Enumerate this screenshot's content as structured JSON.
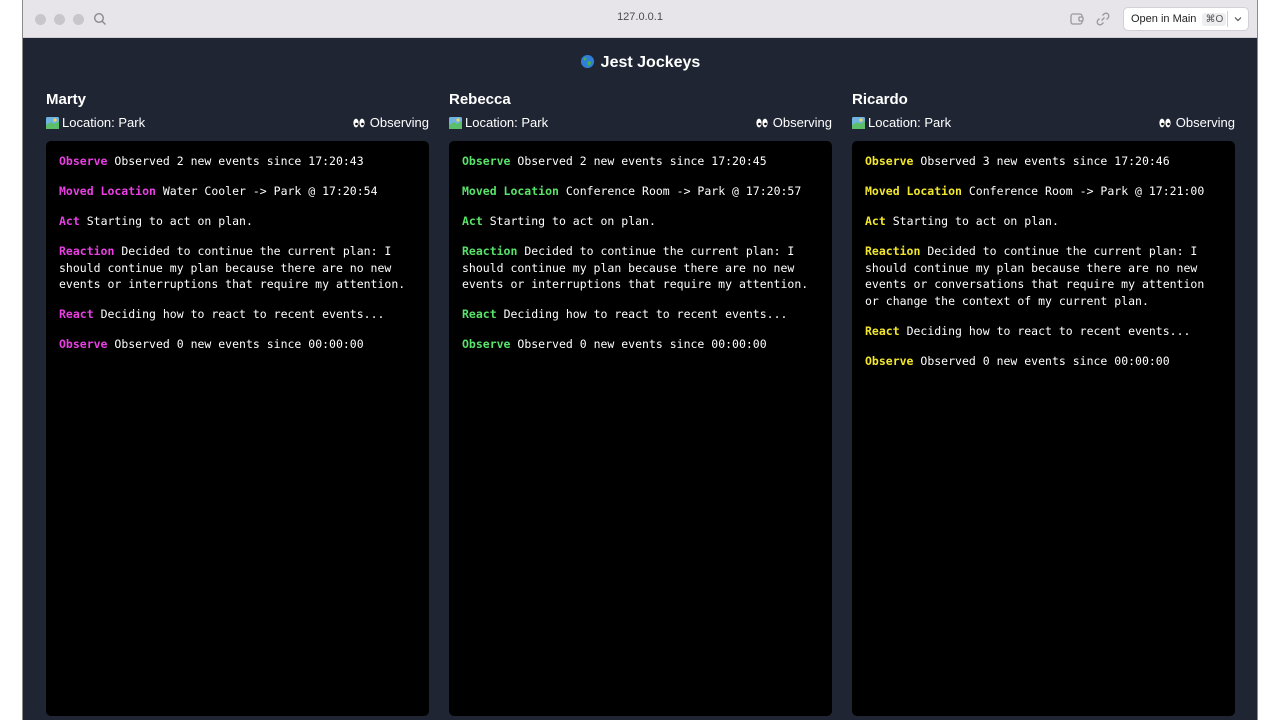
{
  "browser": {
    "url": "127.0.0.1",
    "open_main_label": "Open in Main",
    "open_main_shortcut": "⌘O"
  },
  "app": {
    "title": "Jest Jockeys",
    "title_icon": "globe-icon"
  },
  "agents": [
    {
      "name": "Marty",
      "location": "Location: Park",
      "status": "Observing",
      "accent": "#e93fe3",
      "log": [
        {
          "kind": "Observe",
          "text": "Observed 2 new events since 17:20:43"
        },
        {
          "kind": "Moved Location",
          "text": "Water Cooler -> Park @ 17:20:54"
        },
        {
          "kind": "Act",
          "text": "Starting to act on plan."
        },
        {
          "kind": "Reaction",
          "text": "Decided to continue the current plan: I should continue my plan because there are no new events or interruptions that require my attention."
        },
        {
          "kind": "React",
          "text": "Deciding how to react to recent events..."
        },
        {
          "kind": "Observe",
          "text": "Observed 0 new events since 00:00:00"
        }
      ]
    },
    {
      "name": "Rebecca",
      "location": "Location: Park",
      "status": "Observing",
      "accent": "#58e36a",
      "log": [
        {
          "kind": "Observe",
          "text": "Observed 2 new events since 17:20:45"
        },
        {
          "kind": "Moved Location",
          "text": "Conference Room -> Park @ 17:20:57"
        },
        {
          "kind": "Act",
          "text": "Starting to act on plan."
        },
        {
          "kind": "Reaction",
          "text": "Decided to continue the current plan: I should continue my plan because there are no new events or interruptions that require my attention."
        },
        {
          "kind": "React",
          "text": "Deciding how to react to recent events..."
        },
        {
          "kind": "Observe",
          "text": "Observed 0 new events since 00:00:00"
        }
      ]
    },
    {
      "name": "Ricardo",
      "location": "Location: Park",
      "status": "Observing",
      "accent": "#f2e72c",
      "log": [
        {
          "kind": "Observe",
          "text": "Observed 3 new events since 17:20:46"
        },
        {
          "kind": "Moved Location",
          "text": "Conference Room -> Park @ 17:21:00"
        },
        {
          "kind": "Act",
          "text": "Starting to act on plan."
        },
        {
          "kind": "Reaction",
          "text": "Decided to continue the current plan: I should continue my plan because there are no new events or conversations that require my attention or change the context of my current plan."
        },
        {
          "kind": "React",
          "text": "Deciding how to react to recent events..."
        },
        {
          "kind": "Observe",
          "text": "Observed 0 new events since 00:00:00"
        }
      ]
    }
  ]
}
